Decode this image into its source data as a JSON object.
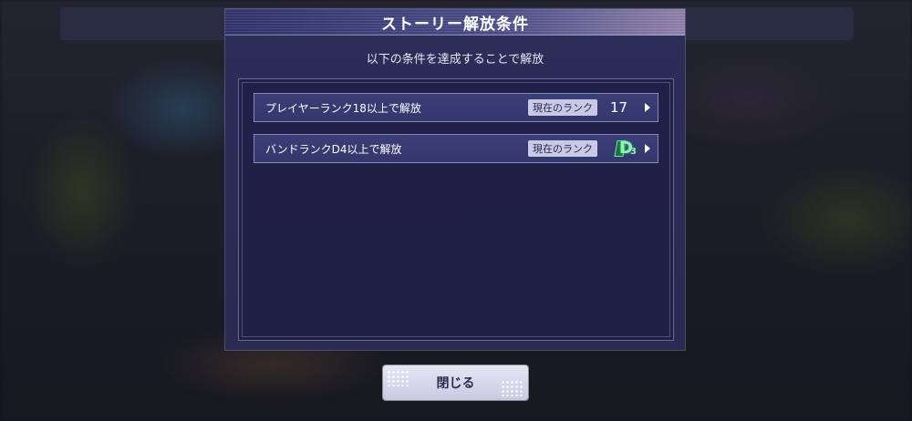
{
  "dialog": {
    "title": "ストーリー解放条件",
    "subtitle": "以下の条件を達成することで解放"
  },
  "conditions": [
    {
      "text": "プレイヤーランク18以上で解放",
      "current_label": "現在のランク",
      "current_value": "17"
    },
    {
      "text": "バンドランクD4以上で解放",
      "current_label": "現在のランク",
      "current_rank_badge": {
        "letter": "D",
        "level": "3",
        "color": "#8ef5b5",
        "icon": "band-rank-badge-icon"
      }
    }
  ],
  "footer": {
    "close_label": "閉じる"
  }
}
